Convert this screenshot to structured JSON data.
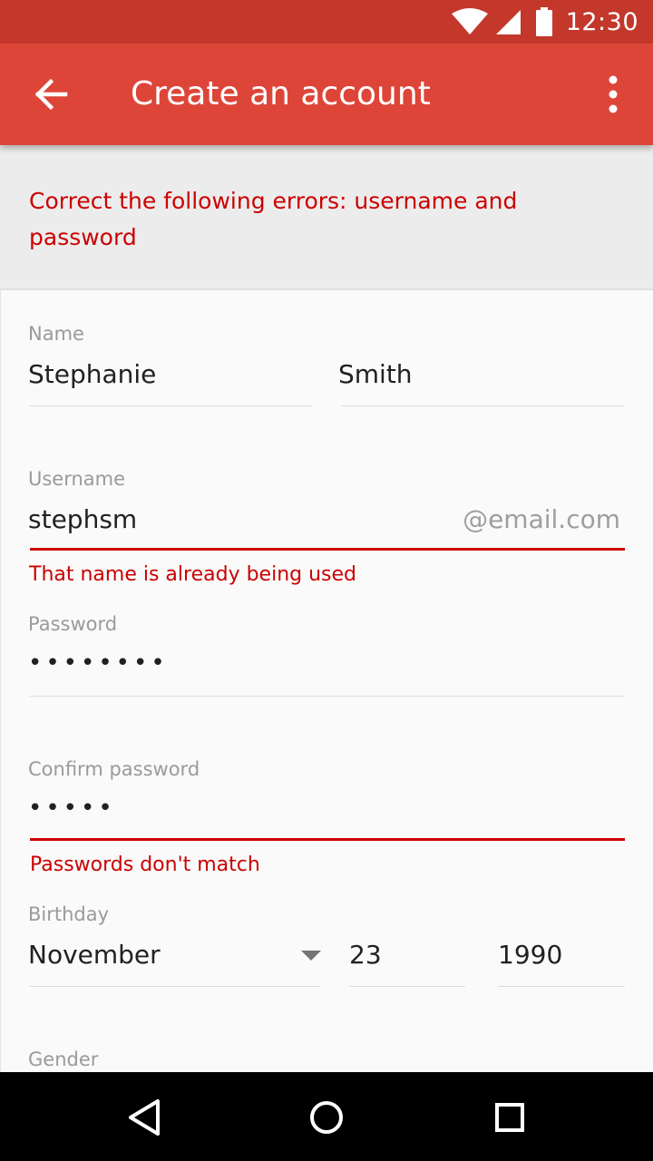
{
  "status_bar": {
    "time": "12:30",
    "icons": [
      "wifi-icon",
      "cellular-signal-icon",
      "battery-icon"
    ],
    "color": "#c4372b"
  },
  "app_bar": {
    "title": "Create an account",
    "color": "#de4539",
    "back_icon": "arrow-back-icon",
    "overflow_icon": "more-vert-icon"
  },
  "error_banner": {
    "text": "Correct the following errors: username and password",
    "color": "#cc0000"
  },
  "form": {
    "name": {
      "label": "Name",
      "first": "Stephanie",
      "last": "Smith"
    },
    "username": {
      "label": "Username",
      "value": "stephsm",
      "suffix": "@email.com",
      "error": "That name is already being used"
    },
    "password": {
      "label": "Password",
      "value": "••••••••"
    },
    "confirm_password": {
      "label": "Confirm password",
      "value": "•••••",
      "error": "Passwords don't match"
    },
    "birthday": {
      "label": "Birthday",
      "month": "November",
      "day": "23",
      "year": "1990"
    },
    "gender": {
      "label": "Gender"
    }
  },
  "nav_bar": {
    "icons": [
      "back-triangle-icon",
      "home-circle-icon",
      "recents-square-icon"
    ]
  }
}
